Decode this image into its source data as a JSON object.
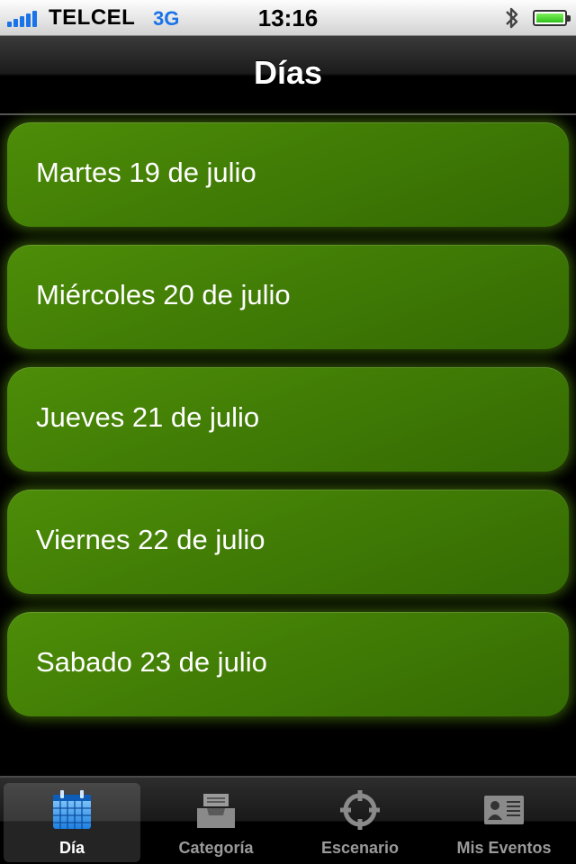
{
  "status_bar": {
    "carrier": "TELCEL",
    "network": "3G",
    "time": "13:16",
    "signal_icon": "signal-bars-icon",
    "bluetooth_icon": "bluetooth-icon",
    "battery_icon": "battery-icon"
  },
  "nav": {
    "title": "Días"
  },
  "days": [
    {
      "label": "Martes 19 de julio"
    },
    {
      "label": "Miércoles 20 de julio"
    },
    {
      "label": "Jueves 21 de julio"
    },
    {
      "label": "Viernes 22 de julio"
    },
    {
      "label": "Sabado 23 de julio"
    }
  ],
  "tabs": [
    {
      "label": "Día",
      "icon": "calendar-icon",
      "active": true
    },
    {
      "label": "Categoría",
      "icon": "inbox-tray-icon",
      "active": false
    },
    {
      "label": "Escenario",
      "icon": "crosshair-icon",
      "active": false
    },
    {
      "label": "Mis Eventos",
      "icon": "contact-card-icon",
      "active": false
    }
  ],
  "colors": {
    "item_green": "#3f7a05",
    "accent_blue": "#1a73e8",
    "battery_green": "#2fc21a"
  }
}
